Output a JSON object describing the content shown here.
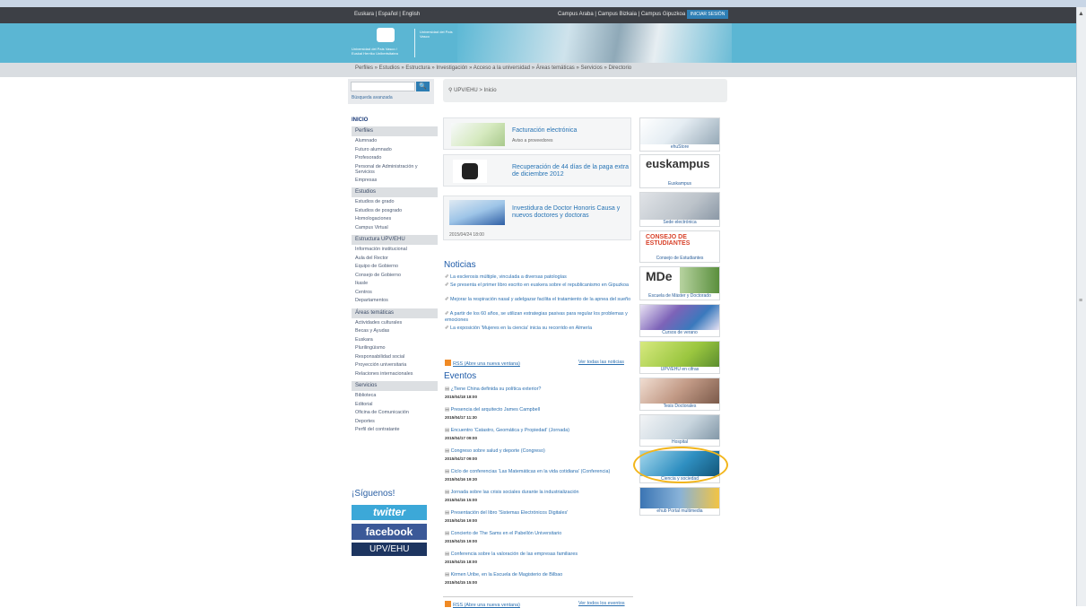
{
  "topbar": {
    "languages": "Euskara | Español | English",
    "campuses": "Campus Araba | Campus Bizkaia | Campus Gipuzkoa",
    "login": "INICIAR SESIÓN"
  },
  "logo": {
    "left_text": "Universidad del País Vasco / Euskal Herriko Unibertsitatea",
    "right_text": "Universidad del País Vasco"
  },
  "main_nav": "Perfiles » Estudios » Estructura » Investigación » Acceso a la universidad » Áreas temáticas » Servicios » Directorio",
  "search": {
    "placeholder": "",
    "button": "🔍",
    "advanced": "Búsqueda avanzada"
  },
  "breadcrumb": "UPV/EHU > Inicio",
  "sidebar": {
    "home": "INICIO",
    "sections": [
      {
        "head": "Perfiles",
        "items": [
          "Alumnado",
          "Futuro alumnado",
          "Profesorado",
          "Personal de Administración y Servicios",
          "Empresas"
        ]
      },
      {
        "head": "Estudios",
        "items": [
          "Estudios de grado",
          "Estudios de posgrado",
          "Homologaciones",
          "Campus Virtual"
        ]
      },
      {
        "head": "Estructura UPV/EHU",
        "items": [
          "Información institucional",
          "Aula del Rector",
          "Equipo de Gobierno",
          "Consejo de Gobierno",
          "Ikasle",
          "Centros",
          "Departamentos"
        ]
      },
      {
        "head": "Áreas temáticas",
        "items": [
          "Actividades culturales",
          "Becas y Ayudas",
          "Euskara",
          "Plurilingüismo",
          "Responsabilidad social",
          "Proyección universitaria",
          "Relaciones internacionales"
        ]
      },
      {
        "head": "Servicios",
        "items": [
          "Biblioteca",
          "Editorial",
          "Oficina de Comunicación",
          "Deportes",
          "Perfil del contratante"
        ]
      }
    ],
    "follow": "¡Síguenos!",
    "twitter": "twitter",
    "facebook": "facebook",
    "upv": "UPV/EHU"
  },
  "featured": [
    {
      "title": "Facturación electrónica",
      "sub": "Aviso a proveedores"
    },
    {
      "title": "Recuperación de 44 días de la paga extra de diciembre 2012",
      "sub": ""
    },
    {
      "title": "Investidura de Doctor Honoris Causa y nuevos doctores y doctoras",
      "sub": "2015/04/24 18:00"
    }
  ],
  "news": {
    "title": "Noticias",
    "items": [
      "La esclerosis múltiple, vinculada a diversas patologías",
      "Se presenta el primer libro escrito en euskera sobre el republicanismo en Gipuzkoa",
      "Mejorar la respiración nasal y adelgazar facilita el tratamiento de la apnea del sueño",
      "A partir de los 60 años, se utilizan estrategias pasivas para regular los problemas y emociones",
      "La exposición 'Mujeres en la ciencia' inicia su recorrido en Almería"
    ],
    "rss": "RSS (Abre una nueva ventana)",
    "all": "Ver todas las noticias"
  },
  "events": {
    "title": "Eventos",
    "items": [
      {
        "title": "¿Tiene China definida su política exterior?",
        "date": "2015/04/18 18:00"
      },
      {
        "title": "Presencia del arquitecto James Campbell",
        "date": "2015/04/17 11:30"
      },
      {
        "title": "Encuentro 'Catastro, Geomática y Propiedad' (Jornada)",
        "date": "2015/04/17 09:00"
      },
      {
        "title": "Congreso sobre salud y deporte (Congreso)",
        "date": "2015/04/17 09:00"
      },
      {
        "title": "Ciclo de conferencias 'Las Matemáticas en la vida cotidiana' (Conferencia)",
        "date": "2015/04/16 19:30"
      },
      {
        "title": "Jornada sobre las crisis sociales durante la industrialización",
        "date": "2015/04/16 15:00"
      },
      {
        "title": "Presentación del libro 'Sistemas Electrónicos Digitales'",
        "date": "2015/04/16 19:00"
      },
      {
        "title": "Concierto de The Sams en el Pabellón Universitario",
        "date": "2015/04/15 19:00"
      },
      {
        "title": "Conferencia sobre la valoración de las empresas familiares",
        "date": "2015/04/15 18:00"
      },
      {
        "title": "Kirmen Uribe, en la Escuela de Magisterio de Bilbao",
        "date": "2015/04/15 15:00"
      }
    ],
    "rss": "RSS (Abre una nueva ventana)",
    "all": "Ver todos los eventos"
  },
  "right_column": [
    {
      "caption": "ehuStore"
    },
    {
      "caption": "Euskampus",
      "logo": "euskampus"
    },
    {
      "caption": "Sede electrónica"
    },
    {
      "caption": "Consejo de Estudiantes",
      "logo": "CONSEJO DE ESTUDIANTES"
    },
    {
      "caption": "Escuela de Máster y Doctorado",
      "logo": "MDe"
    },
    {
      "caption": "Cursos de verano"
    },
    {
      "caption": "UPV/EHU en cifras"
    },
    {
      "caption": "Tesis Doctorales"
    },
    {
      "caption": "Hospital"
    },
    {
      "caption": "Ciencia y sociedad"
    },
    {
      "caption": "ehub Portal multimedia"
    }
  ]
}
